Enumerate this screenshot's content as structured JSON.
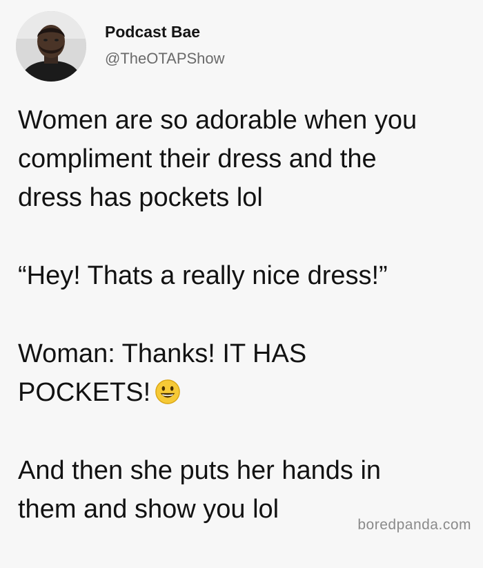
{
  "tweet": {
    "author": {
      "display_name": "Podcast Bae",
      "handle": "@TheOTAPShow",
      "avatar": "profile-photo"
    },
    "paragraphs": [
      {
        "lines": [
          "Women are so adorable when you",
          "compliment their dress and the",
          "dress has pockets lol"
        ]
      },
      {
        "lines": [
          "“Hey! Thats a really nice dress!”"
        ]
      },
      {
        "lines": [
          "Woman: Thanks! IT HAS",
          "POCKETS!"
        ],
        "emoji": "grinning-face-emoji"
      },
      {
        "lines": [
          "And then she puts her hands in",
          "them and show you lol"
        ]
      }
    ]
  },
  "watermark": "boredpanda.com",
  "colors": {
    "background": "#f7f7f7",
    "text": "#121212",
    "handle": "#6a6a6a",
    "watermark": "#8a8a8a",
    "emoji_fill": "#f6c936"
  }
}
